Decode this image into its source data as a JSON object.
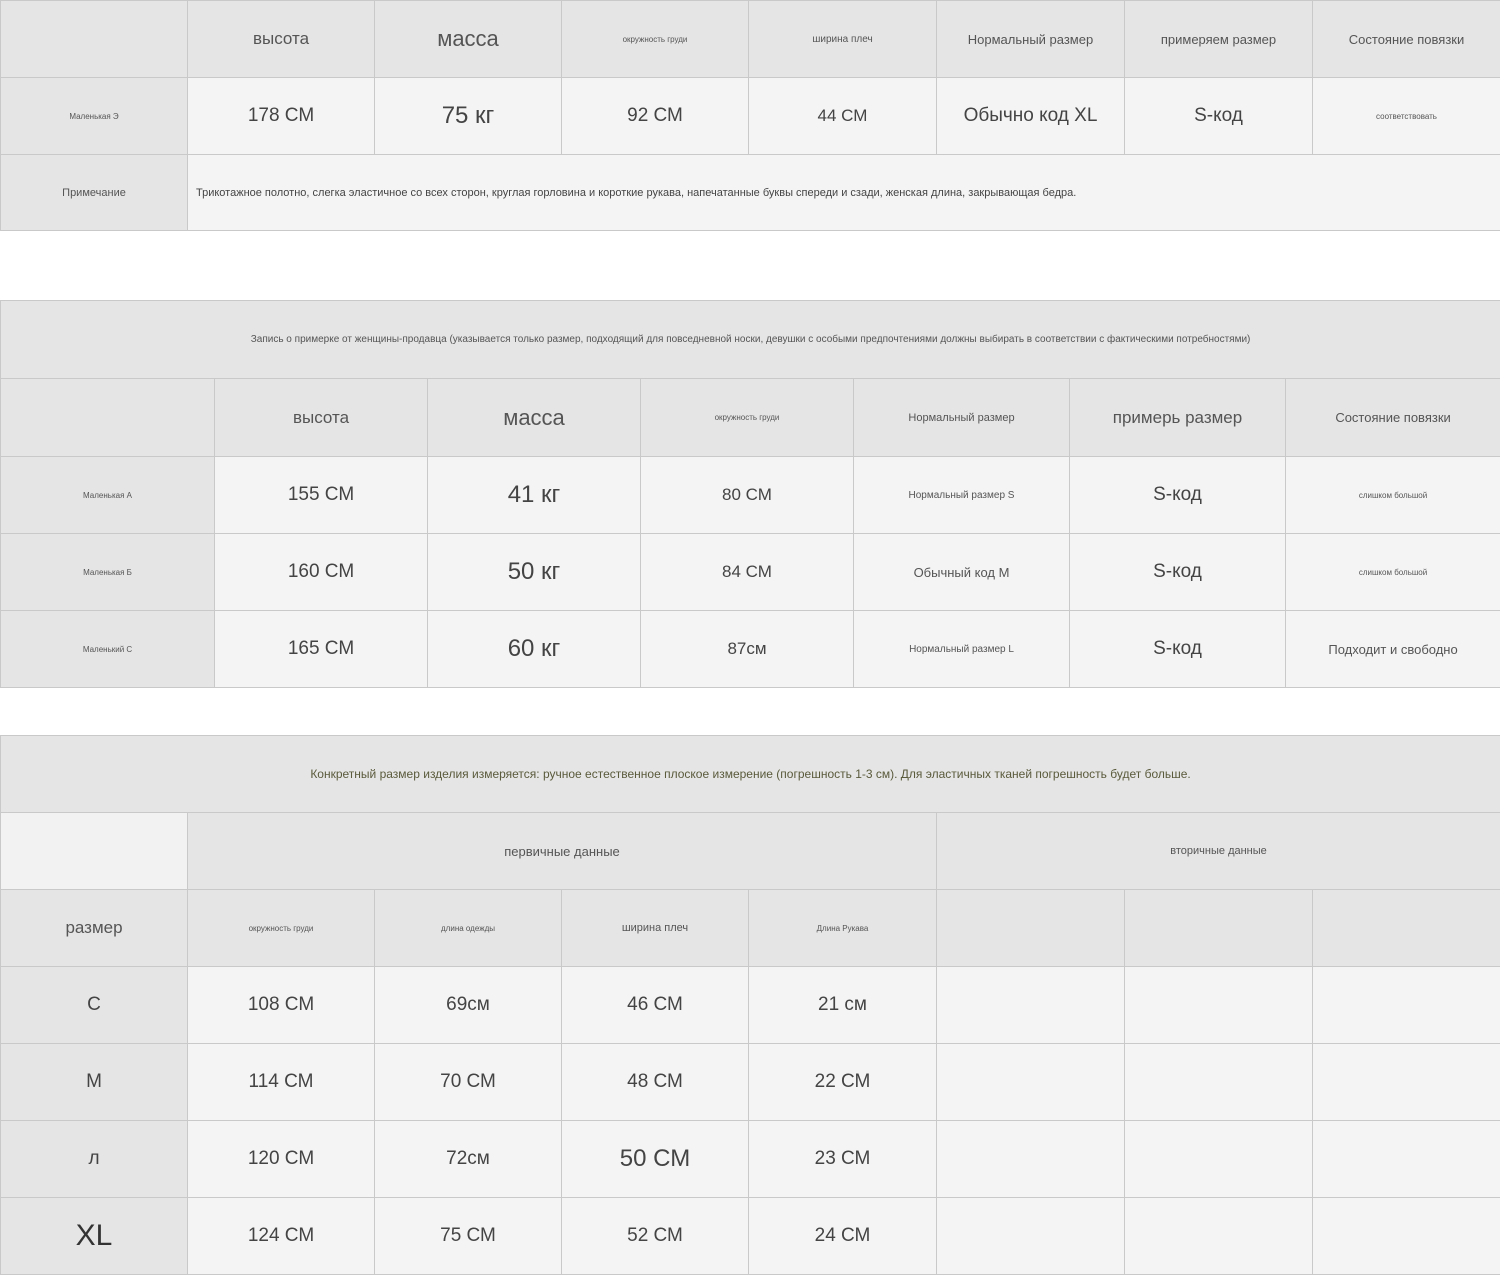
{
  "table1": {
    "headers": {
      "corner": "",
      "height": "высота",
      "weight": "масса",
      "bust": "окружность груди",
      "shoulder": "ширина плеч",
      "normal_size": "Нормальный размер",
      "tried_size": "примеряем размер",
      "fit_state": "Состояние повязки"
    },
    "row": {
      "label": "Маленькая Э",
      "height": "178 СМ",
      "weight": "75 кг",
      "bust": "92 СМ",
      "shoulder": "44 СМ",
      "normal_size": "Обычно код XL",
      "tried_size": "S-код",
      "fit_state": "соответствовать"
    },
    "note_label": "Примечание",
    "note_text": "Трикотажное полотно, слегка эластичное со всех сторон, круглая горловина и короткие рукава, напечатанные буквы спереди и сзади, женская длина, закрывающая бедра."
  },
  "table2": {
    "banner": "Запись о примерке от женщины-продавца (указывается только размер, подходящий для повседневной носки, девушки с особыми предпочтениями должны выбирать в соответствии с фактическими потребностями)",
    "headers": {
      "corner": "",
      "height": "высота",
      "weight": "масса",
      "bust": "окружность груди",
      "normal_size": "Нормальный размер",
      "tried_size": "примерь размер",
      "fit_state": "Состояние повязки"
    },
    "rows": [
      {
        "label": "Маленькая А",
        "height": "155 СМ",
        "weight": "41 кг",
        "bust": "80 СМ",
        "normal_size": "Нормальный размер S",
        "tried_size": "S-код",
        "fit_state": "слишком большой"
      },
      {
        "label": "Маленькая Б",
        "height": "160 СМ",
        "weight": "50 кг",
        "bust": "84 СМ",
        "normal_size": "Обычный код M",
        "tried_size": "S-код",
        "fit_state": "слишком большой"
      },
      {
        "label": "Маленький С",
        "height": "165 СМ",
        "weight": "60 кг",
        "bust": "87см",
        "normal_size": "Нормальный размер L",
        "tried_size": "S-код",
        "fit_state": "Подходит и свободно"
      }
    ]
  },
  "table3": {
    "banner": "Конкретный размер изделия измеряется: ручное естественное плоское измерение (погрешность 1-3 см). Для эластичных тканей погрешность будет больше.",
    "primary": "первичные данные",
    "secondary": "вторичные данные",
    "headers": {
      "size": "размер",
      "bust": "окружность груди",
      "length": "длина одежды",
      "shoulder": "ширина плеч",
      "sleeve": "Длина Рукава"
    },
    "rows": [
      {
        "size": "С",
        "bust": "108 СМ",
        "length": "69см",
        "shoulder": "46 СМ",
        "sleeve": "21 см"
      },
      {
        "size": "М",
        "bust": "114 СМ",
        "length": "70 СМ",
        "shoulder": "48 СМ",
        "sleeve": "22 СМ"
      },
      {
        "size": "л",
        "bust": "120 СМ",
        "length": "72см",
        "shoulder": "50 СМ",
        "sleeve": "23 СМ"
      },
      {
        "size": "XL",
        "bust": "124 СМ",
        "length": "75 СМ",
        "shoulder": "52 СМ",
        "sleeve": "24 СМ"
      }
    ]
  }
}
